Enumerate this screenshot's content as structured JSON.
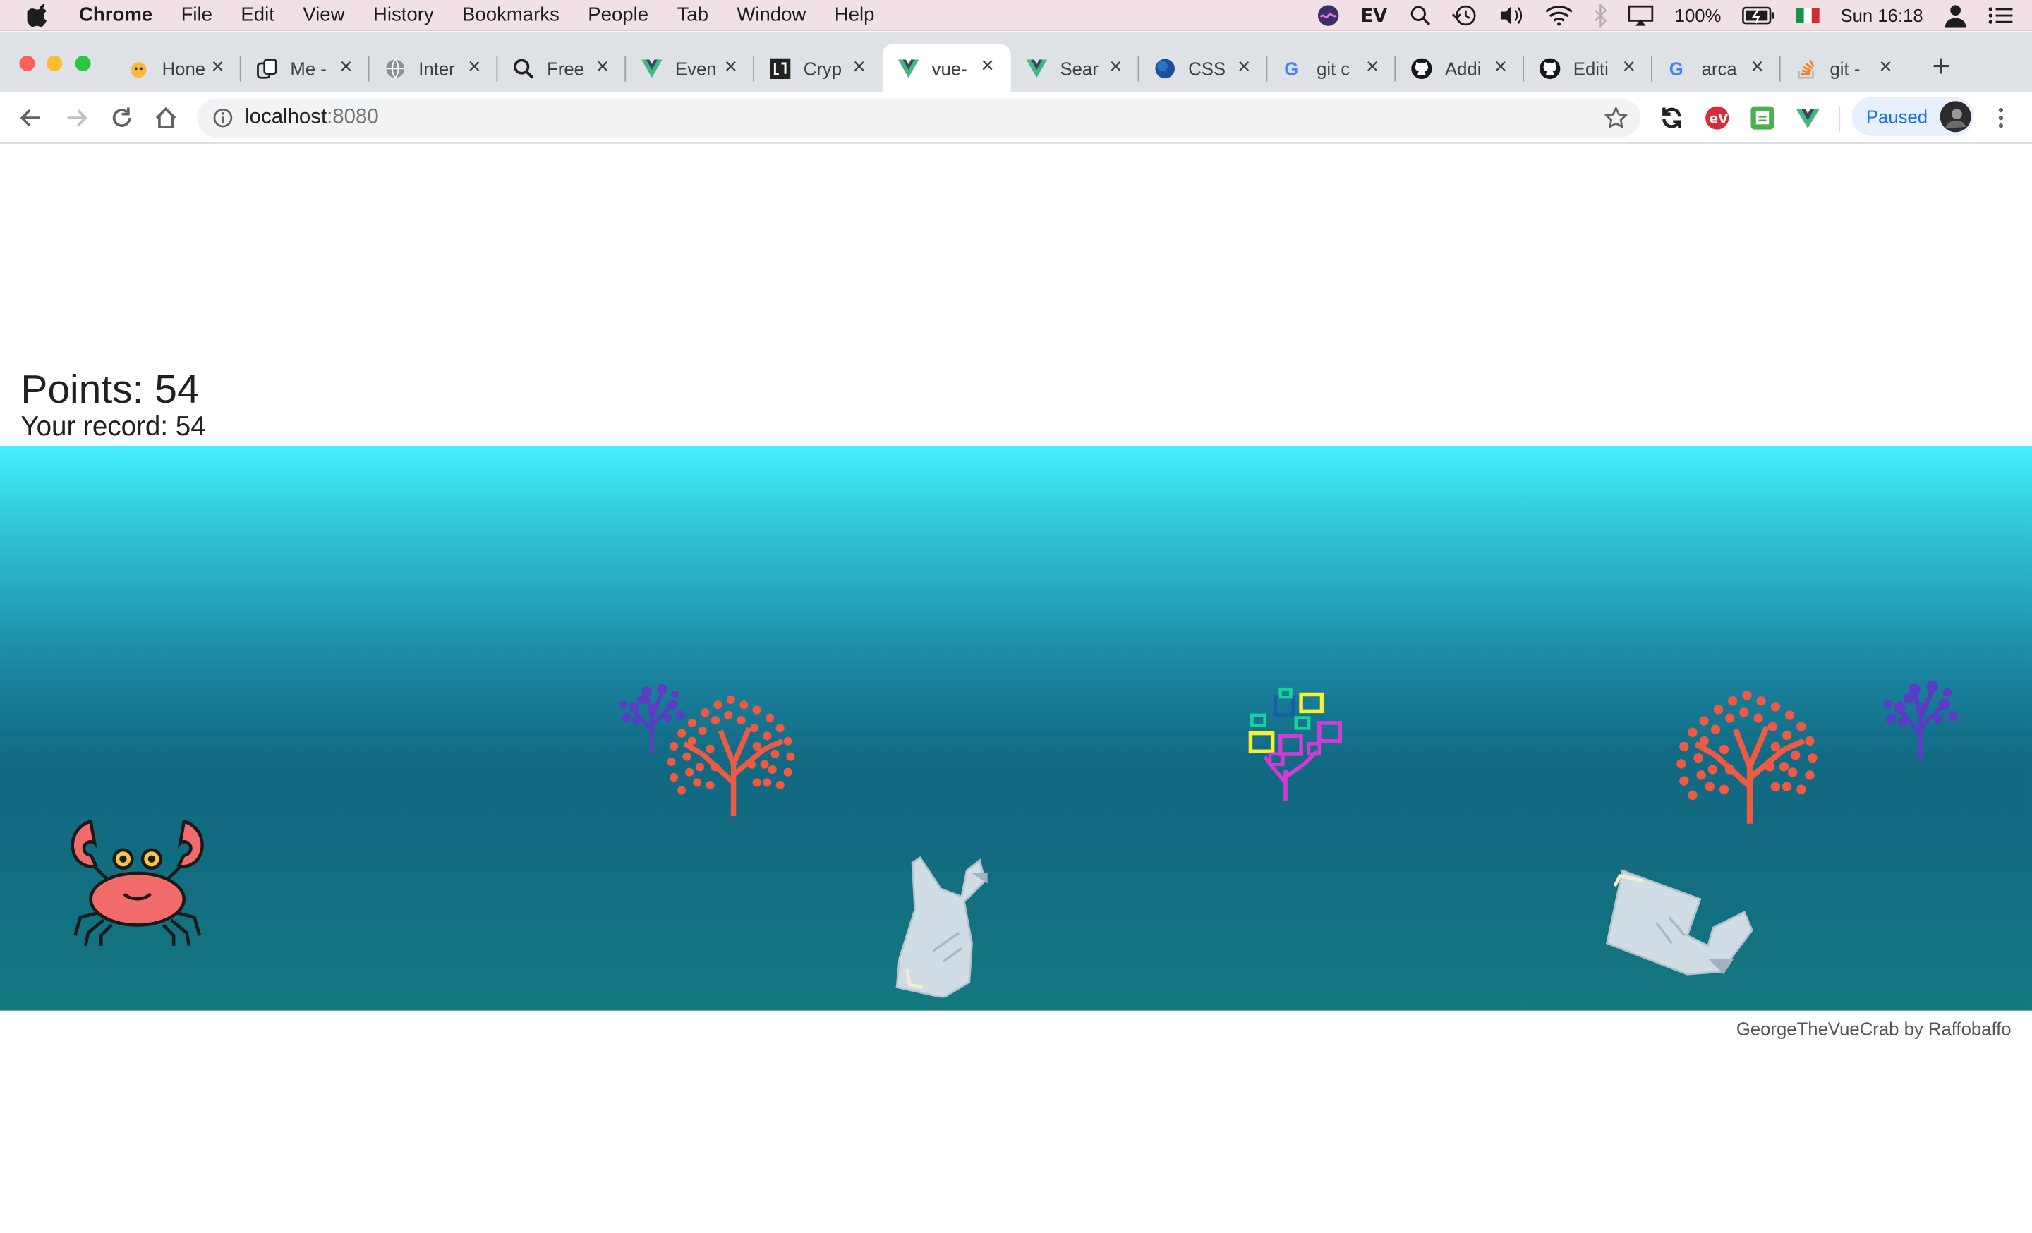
{
  "menubar": {
    "app_name": "Chrome",
    "menus": [
      "File",
      "Edit",
      "View",
      "History",
      "Bookmarks",
      "People",
      "Tab",
      "Window",
      "Help"
    ],
    "battery": "100%",
    "clock": "Sun 16:18"
  },
  "tabs": [
    {
      "title": "Hone",
      "icon": "honey-icon"
    },
    {
      "title": "Me -",
      "icon": "copy-icon"
    },
    {
      "title": "Inter",
      "icon": "globe-icon"
    },
    {
      "title": "Free",
      "icon": "search-icon"
    },
    {
      "title": "Even",
      "icon": "vue-icon"
    },
    {
      "title": "Cryp",
      "icon": "crypto-icon"
    },
    {
      "title": "vue-",
      "icon": "vue-icon",
      "active": true
    },
    {
      "title": "Sear",
      "icon": "vue-icon"
    },
    {
      "title": "CSS",
      "icon": "css-icon"
    },
    {
      "title": "git c",
      "icon": "google-icon"
    },
    {
      "title": "Addi",
      "icon": "github-icon"
    },
    {
      "title": "Editi",
      "icon": "github-icon"
    },
    {
      "title": "arca",
      "icon": "google-icon"
    },
    {
      "title": "git -",
      "icon": "stackoverflow-icon"
    }
  ],
  "address_bar": {
    "host": "localhost",
    "port": ":8080"
  },
  "profile": {
    "label": "Paused"
  },
  "game": {
    "points_label": "Points: 54",
    "record_label": "Your record: 54"
  },
  "footer": {
    "credit": "GeorgeTheVueCrab by Raffobaffo"
  },
  "colors": {
    "sea_top": "#45f0fc",
    "sea_mid": "#126a83",
    "coral_red": "#ef5a44",
    "coral_purple": "#5b3cc4",
    "crab": "#f26b6b",
    "accent_blue": "#1a73e8"
  }
}
